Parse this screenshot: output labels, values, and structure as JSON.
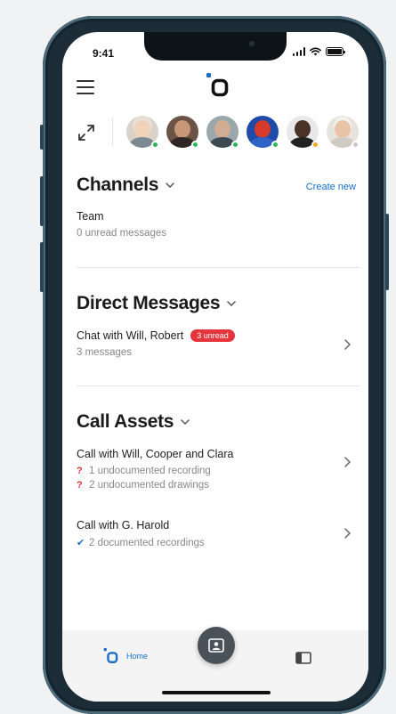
{
  "status_bar": {
    "time": "9:41"
  },
  "channels": {
    "title": "Channels",
    "create_label": "Create new",
    "items": [
      {
        "name": "Team",
        "subtitle": "0 unread messages"
      }
    ]
  },
  "direct_messages": {
    "title": "Direct Messages",
    "items": [
      {
        "name": "Chat with Will, Robert",
        "badge": "3 unread",
        "subtitle": "3 messages"
      }
    ]
  },
  "call_assets": {
    "title": "Call Assets",
    "items": [
      {
        "name": "Call with Will, Cooper and Clara",
        "details": [
          "1 undocumented recording",
          "2 undocumented drawings"
        ]
      },
      {
        "name": "Call with G. Harold",
        "details": [
          "2 documented recordings"
        ]
      }
    ]
  },
  "tab_bar": {
    "home_label": "Home"
  },
  "colors": {
    "accent": "#1a6fc4",
    "unread_badge": "#e5343c",
    "online": "#2fb45a",
    "away": "#f2a81d",
    "offline": "#c7c7c7"
  }
}
